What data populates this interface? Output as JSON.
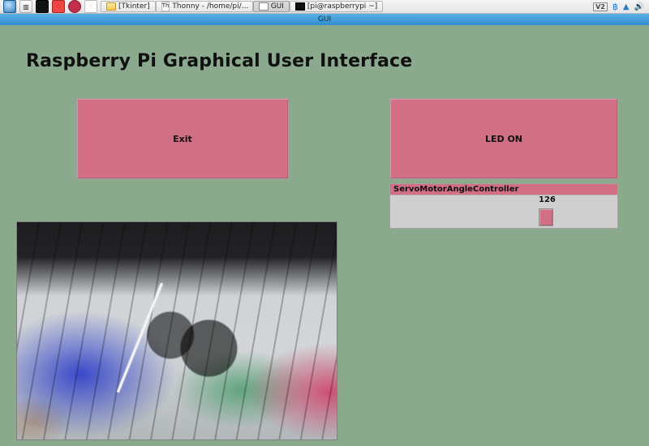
{
  "taskbar": {
    "items": [
      {
        "label": "[Tkinter]"
      },
      {
        "label": "Thonny  -  /home/pi/..."
      },
      {
        "label": "GUI"
      },
      {
        "label": "[pi@raspberrypi ~]"
      }
    ],
    "vnc_badge": "V2"
  },
  "window": {
    "title": "GUI"
  },
  "heading": "Raspberry Pi Graphical User Interface",
  "buttons": {
    "exit_label": "Exit",
    "led_label": "LED ON"
  },
  "servo_scale": {
    "label": "ServoMotorAngleController",
    "value": 126,
    "min": 0,
    "max": 180
  }
}
